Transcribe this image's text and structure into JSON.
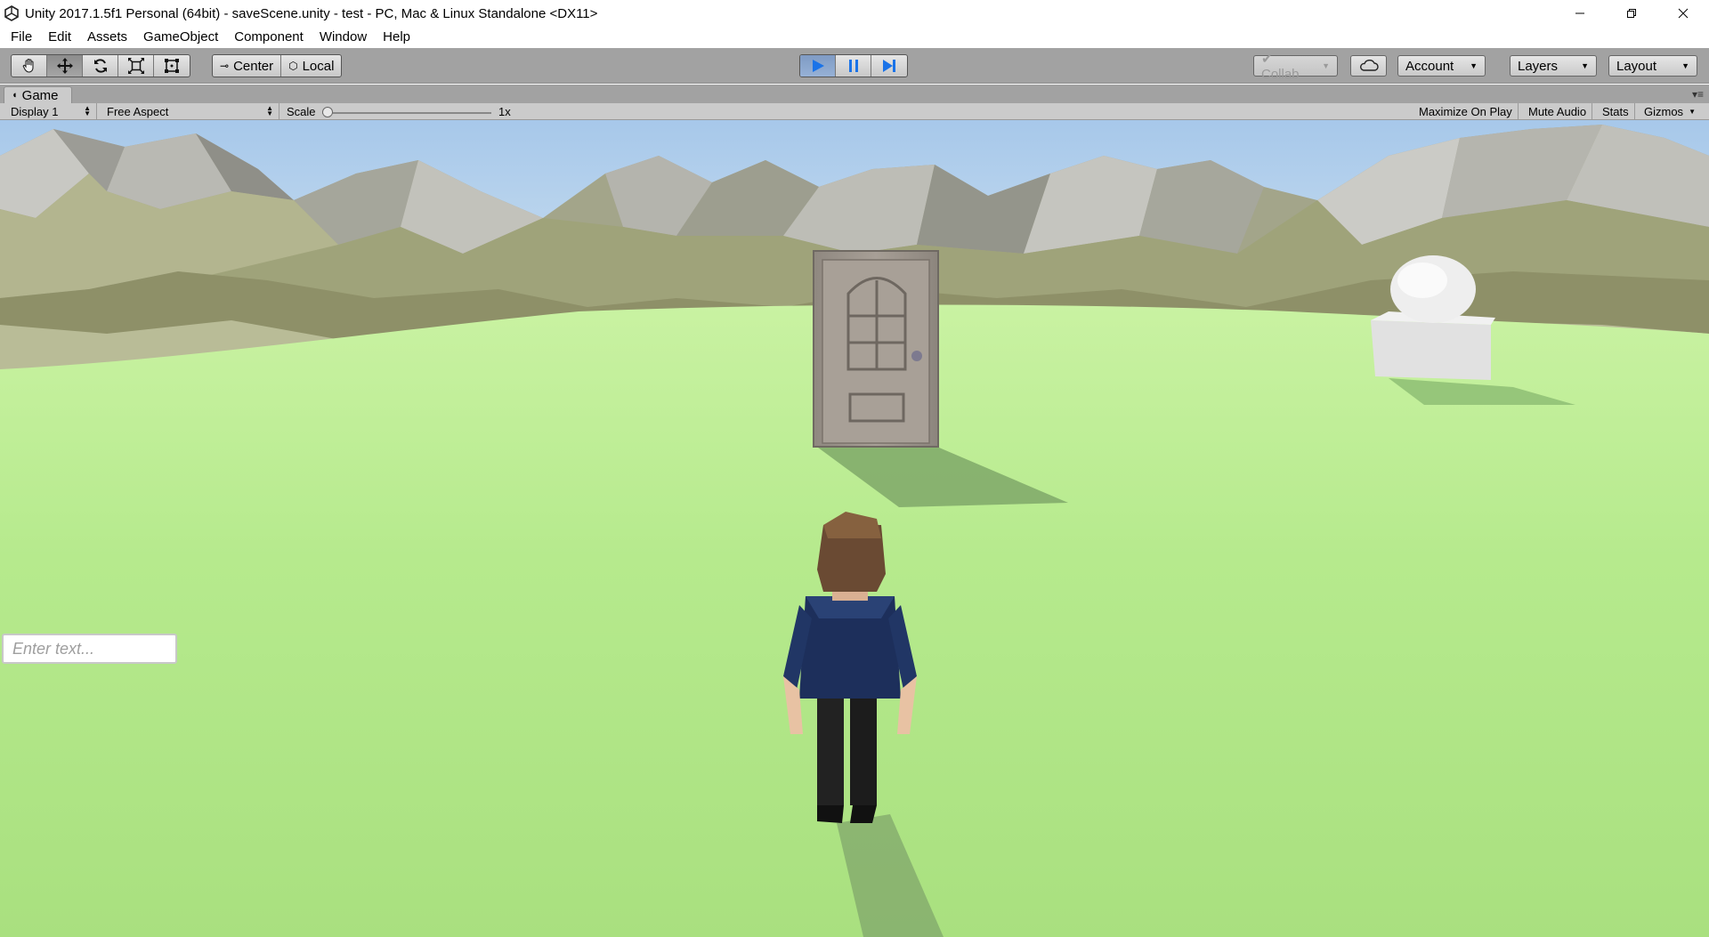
{
  "window": {
    "title": "Unity 2017.1.5f1 Personal (64bit) - saveScene.unity - test - PC, Mac & Linux Standalone <DX11>"
  },
  "menu": [
    "File",
    "Edit",
    "Assets",
    "GameObject",
    "Component",
    "Window",
    "Help"
  ],
  "toolbar": {
    "pivot_mode": "Center",
    "pivot_rotation": "Local",
    "collab": "Collab",
    "account": "Account",
    "layers": "Layers",
    "layout": "Layout"
  },
  "game_panel": {
    "tab_label": "Game",
    "display": "Display 1",
    "aspect": "Free Aspect",
    "scale_label": "Scale",
    "scale_value": "1x",
    "maximize_on_play": "Maximize On Play",
    "mute_audio": "Mute Audio",
    "stats": "Stats",
    "gizmos": "Gizmos"
  },
  "scene_ui": {
    "input_placeholder": "Enter text..."
  },
  "colors": {
    "toolbar_bg": "#a2a2a2",
    "play_active": "#1a73e8",
    "sky_top": "#a9c9e8",
    "grass": "#b5ea8c"
  }
}
